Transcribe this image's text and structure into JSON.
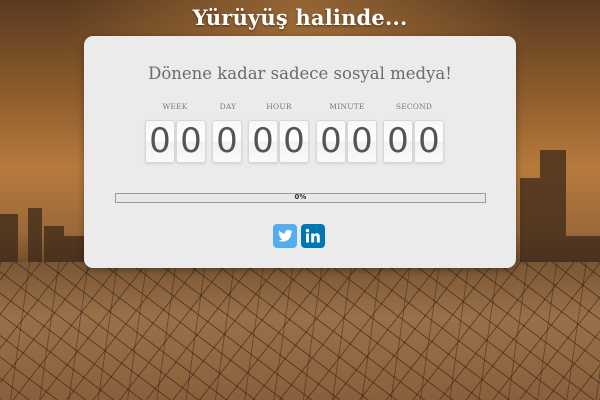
{
  "header": {
    "title": "Yürüyüş halinde..."
  },
  "card": {
    "subtitle": "Dönene kadar sadece sosyal medya!",
    "countdown": {
      "units": [
        {
          "label": "WEEK",
          "digits": [
            "0",
            "0"
          ]
        },
        {
          "label": "DAY",
          "digits": [
            "0"
          ]
        },
        {
          "label": "HOUR",
          "digits": [
            "0",
            "0"
          ]
        },
        {
          "label": "MINUTE",
          "digits": [
            "0",
            "0"
          ]
        },
        {
          "label": "SECOND",
          "digits": [
            "0",
            "0"
          ]
        }
      ]
    },
    "progress": {
      "value": 0,
      "text": "0%"
    },
    "social": [
      {
        "name": "twitter",
        "icon": "twitter-icon",
        "color": "#55acee"
      },
      {
        "name": "linkedin",
        "icon": "linkedin-icon",
        "color": "#0077b5"
      }
    ]
  }
}
